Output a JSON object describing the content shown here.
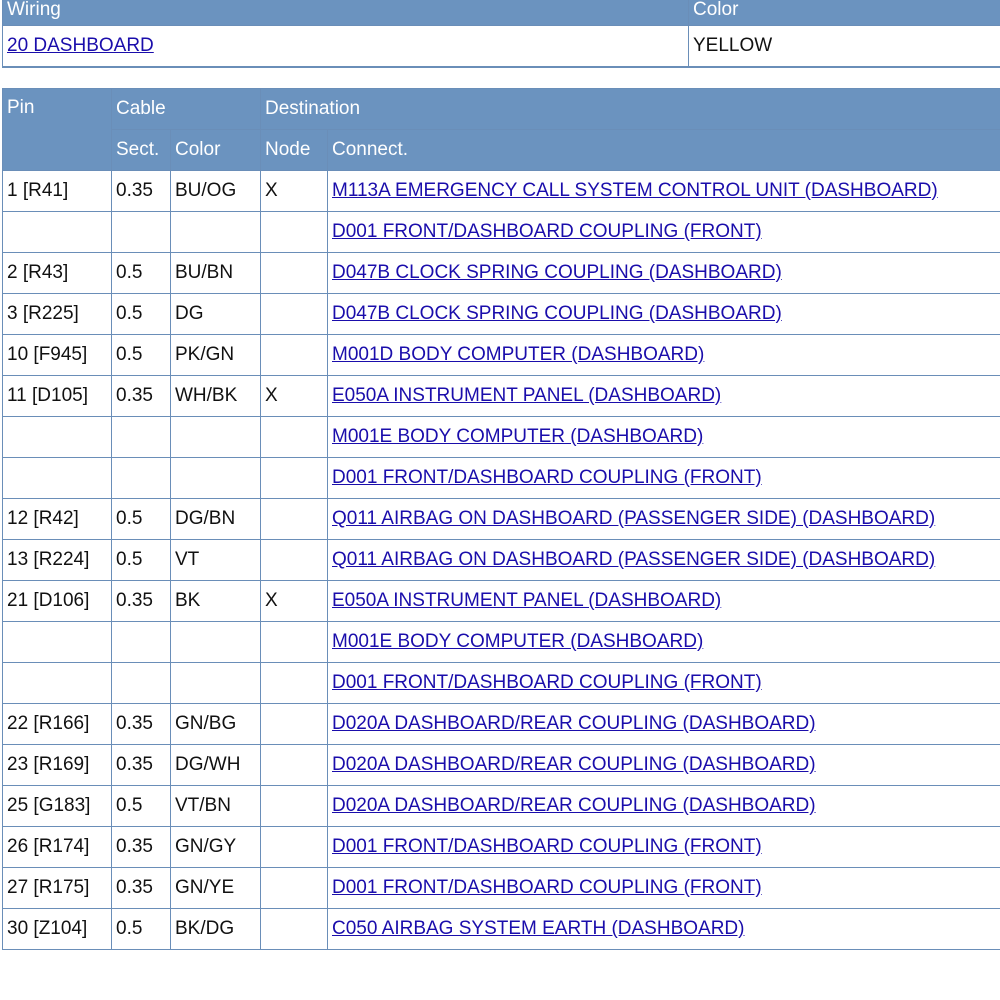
{
  "wiring_table": {
    "headers": {
      "wiring": "Wiring",
      "color": "Color"
    },
    "row": {
      "wiring": "20 DASHBOARD",
      "color": "YELLOW"
    }
  },
  "pin_table": {
    "headers": {
      "pin": "Pin",
      "cable": "Cable",
      "destination": "Destination",
      "sect": "Sect.",
      "color": "Color",
      "node": "Node",
      "connect": "Connect."
    },
    "rows": [
      {
        "pin": "1 [R41]",
        "sect": "0.35",
        "color": "BU/OG",
        "node": "X",
        "connect": "M113A EMERGENCY CALL SYSTEM CONTROL UNIT (DASHBOARD)"
      },
      {
        "pin": "",
        "sect": "",
        "color": "",
        "node": "",
        "connect": "D001 FRONT/DASHBOARD COUPLING (FRONT)"
      },
      {
        "pin": "2 [R43]",
        "sect": "0.5",
        "color": "BU/BN",
        "node": "",
        "connect": "D047B CLOCK SPRING COUPLING (DASHBOARD)"
      },
      {
        "pin": "3 [R225]",
        "sect": "0.5",
        "color": "DG",
        "node": "",
        "connect": "D047B CLOCK SPRING COUPLING (DASHBOARD)"
      },
      {
        "pin": "10 [F945]",
        "sect": "0.5",
        "color": "PK/GN",
        "node": "",
        "connect": "M001D BODY COMPUTER (DASHBOARD)"
      },
      {
        "pin": "11 [D105]",
        "sect": "0.35",
        "color": "WH/BK",
        "node": "X",
        "connect": "E050A INSTRUMENT PANEL (DASHBOARD)"
      },
      {
        "pin": "",
        "sect": "",
        "color": "",
        "node": "",
        "connect": "M001E BODY COMPUTER (DASHBOARD)"
      },
      {
        "pin": "",
        "sect": "",
        "color": "",
        "node": "",
        "connect": "D001 FRONT/DASHBOARD COUPLING (FRONT)"
      },
      {
        "pin": "12 [R42]",
        "sect": "0.5",
        "color": "DG/BN",
        "node": "",
        "connect": "Q011 AIRBAG ON DASHBOARD (PASSENGER SIDE) (DASHBOARD)"
      },
      {
        "pin": "13 [R224]",
        "sect": "0.5",
        "color": "VT",
        "node": "",
        "connect": "Q011 AIRBAG ON DASHBOARD (PASSENGER SIDE) (DASHBOARD)"
      },
      {
        "pin": "21 [D106]",
        "sect": "0.35",
        "color": "BK",
        "node": "X",
        "connect": "E050A INSTRUMENT PANEL (DASHBOARD)"
      },
      {
        "pin": "",
        "sect": "",
        "color": "",
        "node": "",
        "connect": "M001E BODY COMPUTER (DASHBOARD)"
      },
      {
        "pin": "",
        "sect": "",
        "color": "",
        "node": "",
        "connect": "D001 FRONT/DASHBOARD COUPLING (FRONT)"
      },
      {
        "pin": "22 [R166]",
        "sect": "0.35",
        "color": "GN/BG",
        "node": "",
        "connect": "D020A DASHBOARD/REAR COUPLING (DASHBOARD)"
      },
      {
        "pin": "23 [R169]",
        "sect": "0.35",
        "color": "DG/WH",
        "node": "",
        "connect": "D020A DASHBOARD/REAR COUPLING (DASHBOARD)"
      },
      {
        "pin": "25 [G183]",
        "sect": "0.5",
        "color": "VT/BN",
        "node": "",
        "connect": "D020A DASHBOARD/REAR COUPLING (DASHBOARD)"
      },
      {
        "pin": "26 [R174]",
        "sect": "0.35",
        "color": "GN/GY",
        "node": "",
        "connect": "D001 FRONT/DASHBOARD COUPLING (FRONT)"
      },
      {
        "pin": "27 [R175]",
        "sect": "0.35",
        "color": "GN/YE",
        "node": "",
        "connect": "D001 FRONT/DASHBOARD COUPLING (FRONT)"
      },
      {
        "pin": "30 [Z104]",
        "sect": "0.5",
        "color": "BK/DG",
        "node": "",
        "connect": "C050 AIRBAG SYSTEM EARTH (DASHBOARD)"
      }
    ]
  },
  "colors": {
    "header_bg": "#6b93bf",
    "border": "#6a8eb8",
    "link": "#1a0dab"
  }
}
